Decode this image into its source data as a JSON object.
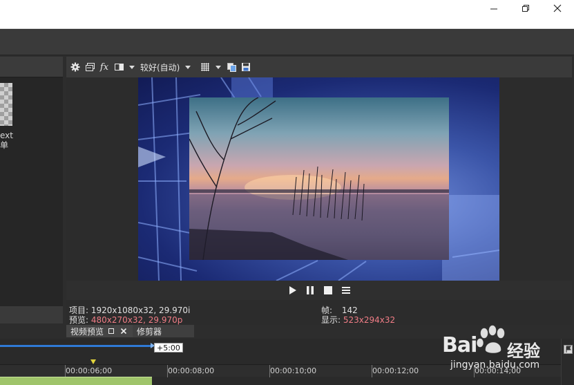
{
  "window": {
    "minimize_icon": "minimize-icon",
    "restore_icon": "restore-icon",
    "close_icon": "close-icon"
  },
  "left_panel": {
    "thumb_label_line1": "ext",
    "thumb_label_line2": "单"
  },
  "preview_toolbar": {
    "quality_label": "较好(自动)",
    "icons": [
      "settings-gear-icon",
      "copy-frame-icon",
      "fx-icon",
      "split-screen-icon",
      "grid-overlay-icon",
      "copy-snapshot-icon",
      "save-snapshot-icon"
    ]
  },
  "transport": {
    "icons": [
      "play-icon",
      "pause-icon",
      "stop-icon",
      "menu-icon"
    ]
  },
  "info": {
    "project_label": "项目:",
    "project_value": "1920x1080x32, 29.970i",
    "preview_label": "预览:",
    "preview_value": "480x270x32, 29.970p",
    "frame_label": "帧:",
    "frame_value": "142",
    "display_label": "显示:",
    "display_value": "523x294x32"
  },
  "tabs": {
    "video_preview": "视频预览",
    "trimmer": "修剪器"
  },
  "timeline": {
    "loop_badge": "+5:00",
    "ticks": [
      "00:00:06;00",
      "00:00:08;00",
      "00:00:10;00",
      "00:00:12;00",
      "00:00:14;00"
    ]
  },
  "watermark": {
    "brand_left": "Bai",
    "brand_right": "经验",
    "url": "jingyan.baidu.com"
  },
  "colors": {
    "accent_blue": "#2f7ad6",
    "info_pink": "#f07d86",
    "marker_yellow": "#e0d23c",
    "clip_green": "#9fc46a"
  }
}
